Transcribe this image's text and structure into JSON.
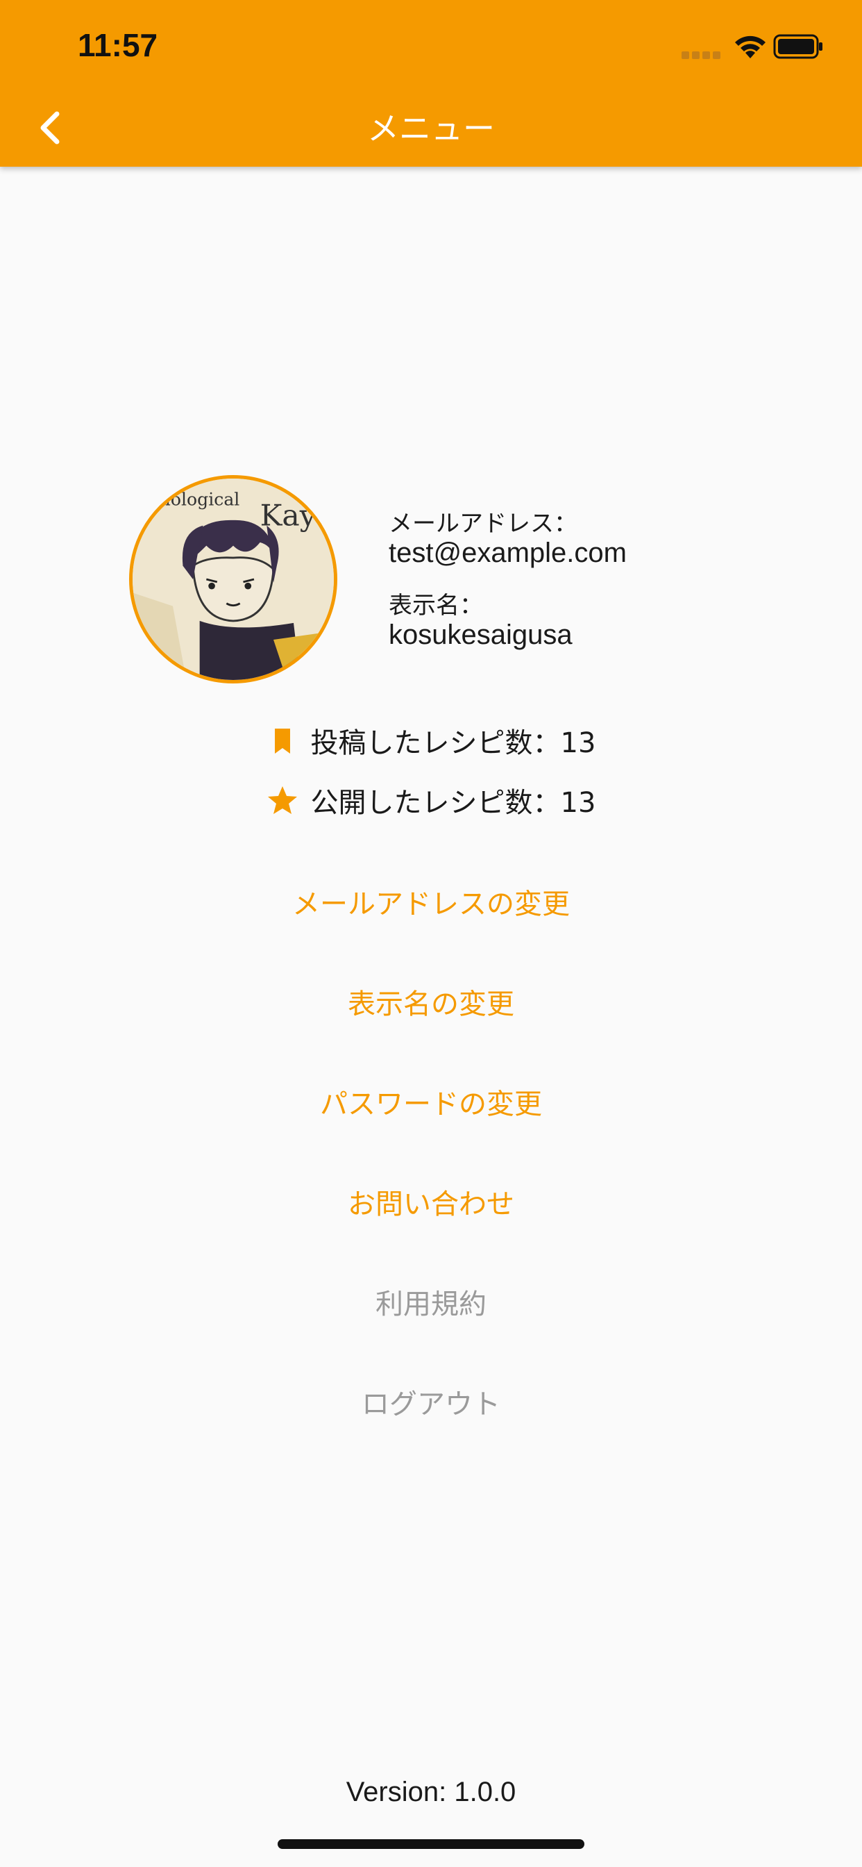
{
  "status_bar": {
    "time": "11:57"
  },
  "nav": {
    "title": "メニュー",
    "back_icon": "chevron-left-icon"
  },
  "profile": {
    "avatar_alt": "avatar",
    "email_label": "メールアドレス：",
    "email_value": "test@example.com",
    "display_name_label": "表示名：",
    "display_name_value": "kosukesaigusa"
  },
  "stats": {
    "posted": {
      "label": "投稿したレシピ数：13",
      "icon": "bookmark-icon"
    },
    "published": {
      "label": "公開したレシピ数：13",
      "icon": "star-icon"
    }
  },
  "menu": {
    "change_email": "メールアドレスの変更",
    "change_display_name": "表示名の変更",
    "change_password": "パスワードの変更",
    "contact": "お問い合わせ",
    "terms": "利用規約",
    "logout": "ログアウト"
  },
  "footer": {
    "version": "Version: 1.0.0"
  },
  "colors": {
    "accent": "#f59a00",
    "muted": "#9a9a9a",
    "background": "#fafafa"
  }
}
